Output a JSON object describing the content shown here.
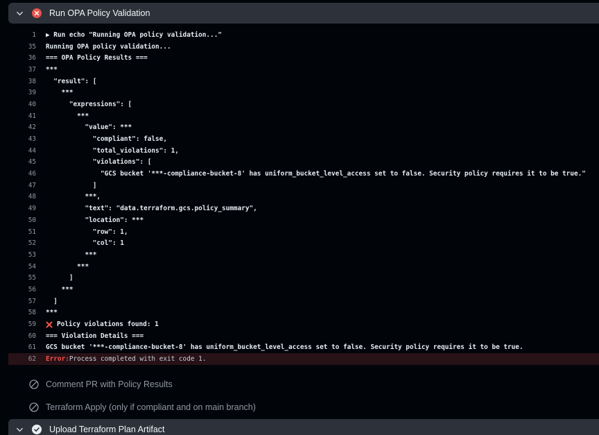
{
  "failed_step": {
    "title": "Run OPA Policy Validation",
    "status": "failed",
    "status_icon": "x-circle-fill-icon",
    "expand_icon": "chevron-down-icon",
    "status_color": "#e5534b"
  },
  "log_lines": [
    {
      "num": "1",
      "text": "▶ Run echo \"Running OPA policy validation...\""
    },
    {
      "num": "35",
      "text": "Running OPA policy validation..."
    },
    {
      "num": "36",
      "text": "=== OPA Policy Results ==="
    },
    {
      "num": "37",
      "text": "***"
    },
    {
      "num": "38",
      "text": "  \"result\": ["
    },
    {
      "num": "39",
      "text": "    ***"
    },
    {
      "num": "40",
      "text": "      \"expressions\": ["
    },
    {
      "num": "41",
      "text": "        ***"
    },
    {
      "num": "42",
      "text": "          \"value\": ***"
    },
    {
      "num": "43",
      "text": "            \"compliant\": false,"
    },
    {
      "num": "44",
      "text": "            \"total_violations\": 1,"
    },
    {
      "num": "45",
      "text": "            \"violations\": ["
    },
    {
      "num": "46",
      "text": "              \"GCS bucket '***-compliance-bucket-8' has uniform_bucket_level_access set to false. Security policy requires it to be true.\""
    },
    {
      "num": "47",
      "text": "            ]"
    },
    {
      "num": "48",
      "text": "          ***,"
    },
    {
      "num": "49",
      "text": "          \"text\": \"data.terraform.gcs.policy_summary\","
    },
    {
      "num": "50",
      "text": "          \"location\": ***"
    },
    {
      "num": "51",
      "text": "            \"row\": 1,"
    },
    {
      "num": "52",
      "text": "            \"col\": 1"
    },
    {
      "num": "53",
      "text": "          ***"
    },
    {
      "num": "54",
      "text": "        ***"
    },
    {
      "num": "55",
      "text": "      ]"
    },
    {
      "num": "56",
      "text": "    ***"
    },
    {
      "num": "57",
      "text": "  ]"
    },
    {
      "num": "58",
      "text": "***"
    },
    {
      "num": "59",
      "text": "Policy violations found: 1",
      "icon": "red-x-icon"
    },
    {
      "num": "60",
      "text": "=== Violation Details ==="
    },
    {
      "num": "61",
      "text": "GCS bucket '***-compliance-bucket-8' has uniform_bucket_level_access set to false. Security policy requires it to be true."
    }
  ],
  "error_line": {
    "num": "62",
    "label": "Error:",
    "message": "Process completed with exit code 1."
  },
  "pending_steps": [
    {
      "label": "Comment PR with Policy Results",
      "icon": "skipped-circle-icon"
    },
    {
      "label": "Terraform Apply (only if compliant and on main branch)",
      "icon": "skipped-circle-icon"
    }
  ],
  "next_step": {
    "title": "Upload Terraform Plan Artifact",
    "status": "success",
    "status_icon": "check-circle-fill-icon",
    "expand_icon": "chevron-down-icon"
  }
}
